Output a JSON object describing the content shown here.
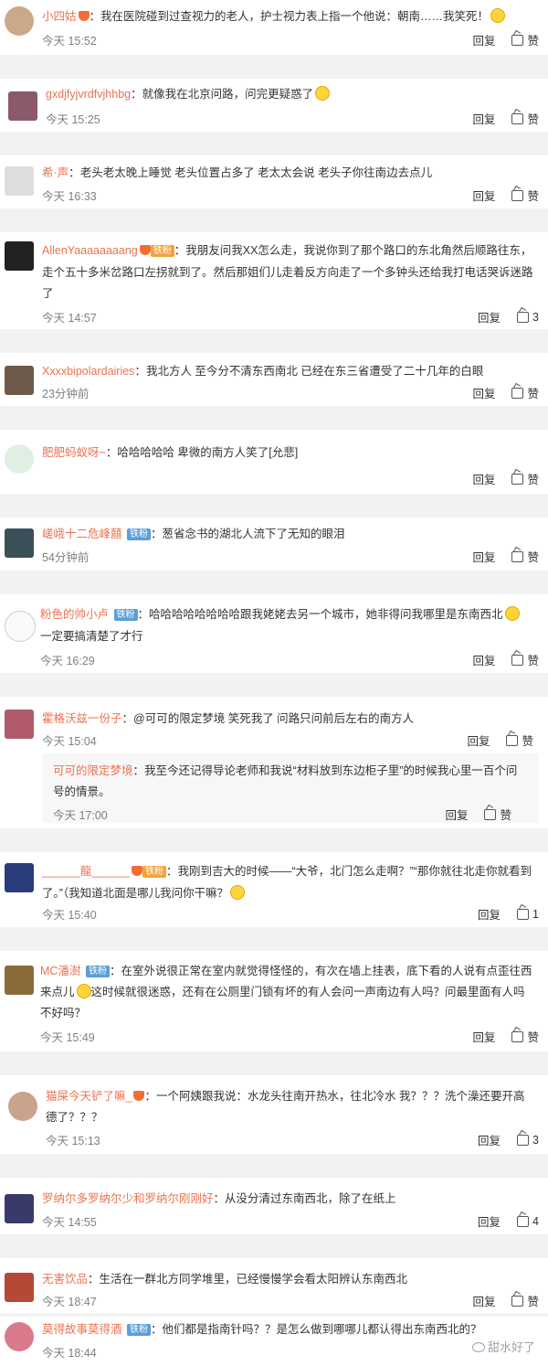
{
  "comments": [
    {
      "user": "小四姑",
      "text": "我在医院碰到过查视力的老人，护士视力表上指一个他说：朝南……我笑死！",
      "time": "今天 15:52",
      "reply": "回复",
      "like": "赞"
    },
    {
      "user": "gxdjfyjvrdfvjhhbg",
      "text": "就像我在北京问路，问完更疑惑了",
      "time": "今天 15:25",
      "reply": "回复",
      "like": "赞"
    },
    {
      "user": "希·声",
      "text": "老头老太晚上睡觉 老头位置占多了 老太太会说 老头子你往南边去点儿",
      "time": "今天 16:33",
      "reply": "回复",
      "like": "赞"
    },
    {
      "user": "AllenYaaaaaaaang",
      "badge": "铁粉",
      "text": "我朋友问我XX怎么走，我说你到了那个路口的东北角然后顺路往东，",
      "text2": "走个五十多米岔路口左拐就到了。然后那姐们儿走着反方向走了一个多钟头还给我打电话哭诉迷路",
      "text3": "了",
      "time": "今天 14:57",
      "reply": "回复",
      "like": "3"
    },
    {
      "user": "Xxxxbipolardairies",
      "text": "我北方人 至今分不清东西南北 已经在东三省遭受了二十几年的白眼",
      "time": "23分钟前",
      "reply": "回复",
      "like": "赞"
    },
    {
      "user": "肥肥蚂蚁呀~",
      "text": "哈哈哈哈哈 卑微的南方人笑了[允悲]",
      "time": "",
      "reply": "回复",
      "like": "赞"
    },
    {
      "user": "嵯峨十二危峰囍",
      "badge": "铁粉",
      "text": "葱省念书的湖北人流下了无知的眼泪",
      "time": "54分钟前",
      "reply": "回复",
      "like": "赞"
    },
    {
      "user": "粉色的帅小卢",
      "badge": "铁粉",
      "text": "哈哈哈哈哈哈哈哈跟我姥姥去另一个城市，她非得问我哪里是东南西北",
      "text2": "一定要搞清楚了才行",
      "time": "今天 16:29",
      "reply": "回复",
      "like": "赞"
    },
    {
      "user": "霍格沃兹一份子",
      "text": "@可可的限定梦境 笑死我了 问路只问前后左右的南方人",
      "time": "今天 15:04",
      "reply": "回复",
      "like": "赞",
      "nested": {
        "user": "可可的限定梦境",
        "text": "我至今还记得导论老师和我说“材料放到东边柜子里”的时候我心里一百个问",
        "text2": "号的情景。",
        "time": "今天 17:00",
        "reply": "回复",
        "like": "赞"
      }
    },
    {
      "user": "______龍______",
      "badge": "铁粉",
      "text": "我刚到吉大的时候——“大爷，北门怎么走啊？”“那你就往北走你就看到",
      "text2": "了。”（我知道北面是哪儿我问你干嘛？",
      "time": "今天 15:40",
      "reply": "回复",
      "like": "1"
    },
    {
      "user": "MC潘澍",
      "badge": "铁粉",
      "text": "在室外说很正常在室内就觉得怪怪的，有次在墙上挂表，底下看的人说有点歪往西",
      "text2": "来点儿",
      "text2b": "这时候就很迷惑，还有在公厕里门锁有坏的有人会问一声南边有人吗？问最里面有人吗",
      "text3": "不好吗？",
      "time": "今天 15:49",
      "reply": "回复",
      "like": "赞"
    },
    {
      "user": "猫屎今天铲了嘛_",
      "text": "一个阿姨跟我说：水龙头往南开热水，往北冷水 我？？？洗个澡还要开高",
      "text2": "德了？？？",
      "time": "今天 15:13",
      "reply": "回复",
      "like": "3"
    },
    {
      "user": "罗纳尔多罗纳尔少和罗纳尔刚刚好",
      "text": "从没分清过东南西北，除了在纸上",
      "time": "今天 14:55",
      "reply": "回复",
      "like": "4"
    },
    {
      "user": "无害饮品",
      "text": "生活在一群北方同学堆里，已经慢慢学会看太阳辨认东南西北",
      "time": "今天 18:47",
      "reply": "回复",
      "like": "赞"
    },
    {
      "user": "莫得故事莫得酒",
      "badge": "铁粉",
      "text": "他们都是指南针吗？？是怎么做到哪哪儿都认得出东南西北的？",
      "time": "今天 18:44",
      "reply": "回复",
      "like": ""
    }
  ],
  "watermark": "甜水好了",
  "colors": {
    "username": "#eb7350",
    "badge": "#5b9ed8",
    "separator": "#f2f2f2"
  }
}
